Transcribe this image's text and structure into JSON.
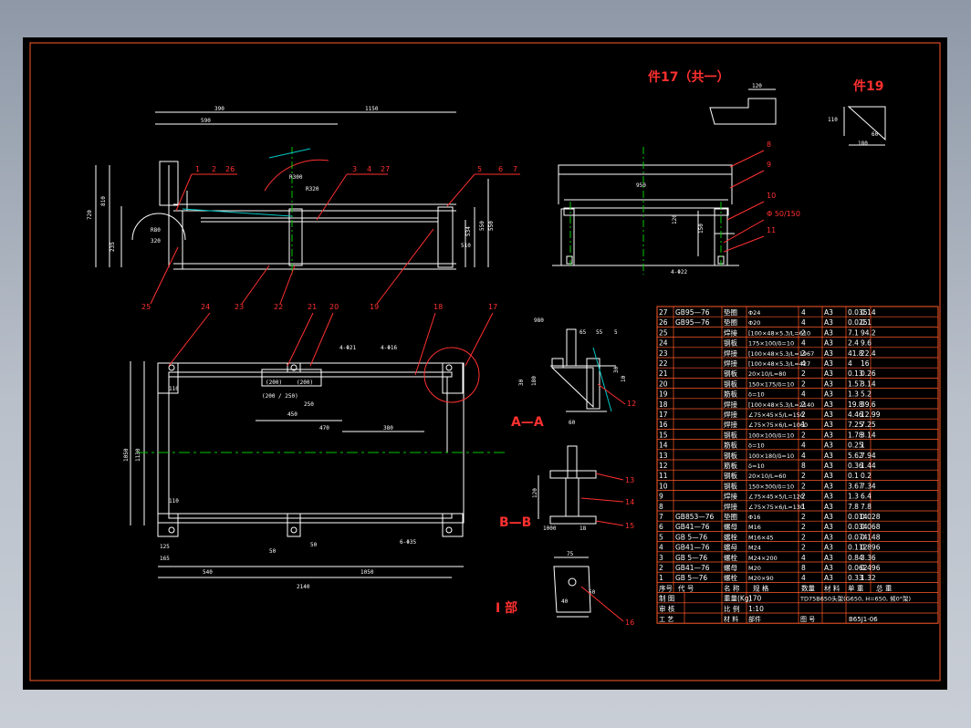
{
  "colors": {
    "background": "#000000",
    "border": "#ff5a2a",
    "geometry": "#ffffff",
    "centerline": "#00c800",
    "leader": "#ff3030",
    "hatch": "#00c8c8",
    "dimension": "#ffffff"
  },
  "views": {
    "front": {
      "dims": [
        "390",
        "590",
        "1150",
        "720",
        "810",
        "550",
        "235",
        "510",
        "534",
        "550",
        "R300",
        "R80",
        "320",
        "R320"
      ],
      "callouts": [
        "1",
        "2",
        "26",
        "3",
        "4",
        "27",
        "5",
        "6",
        "7",
        "25",
        "23",
        "22",
        "19"
      ]
    },
    "side": {
      "dims": [
        "950",
        "120",
        "150",
        "4-Φ22"
      ],
      "callouts": [
        "8",
        "9",
        "10",
        "Φ 50/150",
        "11"
      ]
    },
    "top": {
      "dims": [
        "110",
        "4-Φ21",
        "4-Φ16",
        "(200)",
        "(200)",
        "(200 / 250)",
        "250",
        "450",
        "470",
        "380",
        "1050",
        "1130",
        "110",
        "125",
        "165",
        "50",
        "50",
        "540",
        "1050",
        "2140",
        "6-Φ35"
      ],
      "callouts": [
        "24",
        "21",
        "20",
        "18",
        "17"
      ]
    },
    "detail_17": {
      "title": "件17（共一）",
      "dims": [
        "120"
      ]
    },
    "detail_19": {
      "title": "件19",
      "dims": [
        "110",
        "60",
        "180"
      ]
    },
    "section_aa": {
      "title": "A—A",
      "dims": [
        "980",
        "65",
        "55",
        "5",
        "30",
        "180",
        "30",
        "60",
        "10"
      ],
      "callouts": [
        "12"
      ]
    },
    "section_bb": {
      "title": "B—B",
      "dims": [
        "120",
        "1000",
        "18"
      ],
      "callouts": [
        "13",
        "14",
        "15"
      ]
    },
    "detail_i": {
      "title": "I 部",
      "dims": [
        "75",
        "40",
        "50"
      ],
      "callouts": [
        "16"
      ]
    }
  },
  "bom": {
    "rows": [
      [
        "27",
        "GB95—76",
        "垫圈",
        "Φ24",
        "4",
        "A3",
        "0.035",
        "0.14"
      ],
      [
        "26",
        "GB95—76",
        "垫圈",
        "Φ20",
        "4",
        "A3",
        "0.025",
        "0.1"
      ],
      [
        "25",
        "",
        "焊接",
        "[100×48×5.3/L=610",
        "2",
        "A3",
        "7.1",
        "94.2"
      ],
      [
        "24",
        "",
        "钢板",
        "175×100/δ=10",
        "4",
        "A3",
        "2.4",
        "9.6"
      ],
      [
        "23",
        "",
        "焊接",
        "[100×48×5.3/L=1967",
        "2",
        "A3",
        "41.8",
        "22.4"
      ],
      [
        "22",
        "",
        "焊接",
        "[100×48×5.3/L=427",
        "4",
        "A3",
        "4",
        "16"
      ],
      [
        "21",
        "",
        "钢板",
        "20×10/L=80",
        "2",
        "A3",
        "0.13",
        "0.26"
      ],
      [
        "20",
        "",
        "钢板",
        "150×175/δ=10",
        "2",
        "A3",
        "1.57",
        "3.14"
      ],
      [
        "19",
        "",
        "筋板",
        "δ=10",
        "4",
        "A3",
        "1.3",
        "5.2"
      ],
      [
        "18",
        "",
        "焊接",
        "[100×48×5.3/L=2140",
        "2",
        "A3",
        "19.8",
        "39.6"
      ],
      [
        "17",
        "",
        "焊接",
        "∠75×45×5/L=150",
        "2",
        "A3",
        "4.46",
        "12.99"
      ],
      [
        "16",
        "",
        "焊接",
        "∠75×75×6/L=1060",
        "1",
        "A3",
        "7.25",
        "7.25"
      ],
      [
        "15",
        "",
        "钢板",
        "100×100/δ=10",
        "2",
        "A3",
        "1.78",
        "3.14"
      ],
      [
        "14",
        "",
        "筋板",
        "δ=10",
        "4",
        "A3",
        "0.25",
        "1"
      ],
      [
        "13",
        "",
        "钢板",
        "100×180/δ=10",
        "4",
        "A3",
        "5.62",
        "7.94"
      ],
      [
        "12",
        "",
        "筋板",
        "δ=10",
        "8",
        "A3",
        "0.36",
        "1.44"
      ],
      [
        "11",
        "",
        "钢板",
        "20×10/L=60",
        "2",
        "A3",
        "0.1",
        "0.2"
      ],
      [
        "10",
        "",
        "钢板",
        "150×300/δ=10",
        "2",
        "A3",
        "3.67",
        "7.34"
      ],
      [
        "9",
        "",
        "焊接",
        "∠75×45×5/L=120",
        "2",
        "A3",
        "1.3",
        "6.4"
      ],
      [
        "8",
        "",
        "焊接",
        "∠75×75×6/L=130",
        "1",
        "A3",
        "7.8",
        "7.8"
      ],
      [
        "7",
        "GB853—76",
        "垫圈",
        "Φ16",
        "2",
        "A3",
        "0.014",
        "0.028"
      ],
      [
        "6",
        "GB41—76",
        "螺母",
        "M16",
        "2",
        "A3",
        "0.034",
        "0.068"
      ],
      [
        "5",
        "GB 5—76",
        "螺栓",
        "M16×45",
        "2",
        "A3",
        "0.074",
        "0.148"
      ],
      [
        "4",
        "GB41—76",
        "螺母",
        "M24",
        "2",
        "A3",
        "0.112",
        "0.896"
      ],
      [
        "3",
        "GB 5—76",
        "螺栓",
        "M24×200",
        "4",
        "A3",
        "0.84",
        "3.36"
      ],
      [
        "2",
        "GB41—76",
        "螺母",
        "M20",
        "8",
        "A3",
        "0.062",
        "0.496"
      ],
      [
        "1",
        "GB 5—76",
        "螺栓",
        "M20×90",
        "4",
        "A3",
        "0.33",
        "1.32"
      ]
    ],
    "header": [
      "序号",
      "代 号",
      "名 称",
      "规 格",
      "数量",
      "材 料",
      "单 重",
      "总 重"
    ],
    "title_block": {
      "r1": [
        "制 图",
        "",
        "重量(Kg)",
        "170",
        "TD75B650头架(G650, H=650, 倾0°架)"
      ],
      "r2": [
        "审 核",
        "",
        "比 例",
        "1:10"
      ],
      "r3": [
        "工 艺",
        "",
        "材 料",
        "部件",
        "图 号",
        "B65J1-06"
      ]
    }
  }
}
